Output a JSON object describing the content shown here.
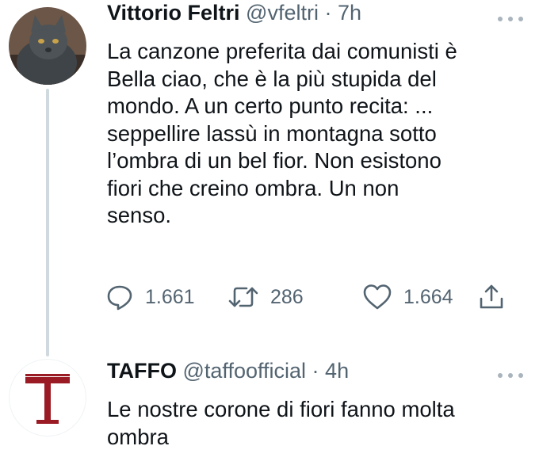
{
  "tweets": [
    {
      "author_name": "Vittorio Feltri",
      "handle": "@vfeltri",
      "separator": "·",
      "time": "7h",
      "lines": [
        "La canzone preferita dai comunisti è",
        "Bella ciao, che è la più stupida del",
        "mondo. A un certo punto recita: ...",
        "seppellire lassù in montagna sotto",
        "l’ombra di un bel fior. Non esistono",
        "fiori che creino ombra. Un non",
        "senso."
      ],
      "stats": {
        "replies": "1.661",
        "retweets": "286",
        "likes": "1.664"
      }
    },
    {
      "author_name": "TAFFO",
      "handle": "@taffoofficial",
      "separator": "·",
      "time": "4h",
      "lines": [
        "Le nostre corone di fiori fanno molta",
        "ombra"
      ]
    }
  ],
  "colors": {
    "text": "#0f1419",
    "muted": "#536471",
    "thread": "#cfd9de",
    "taffo_logo": "#9b1b24"
  },
  "icons": [
    "more-icon",
    "reply-icon",
    "retweet-icon",
    "like-icon",
    "share-icon"
  ]
}
